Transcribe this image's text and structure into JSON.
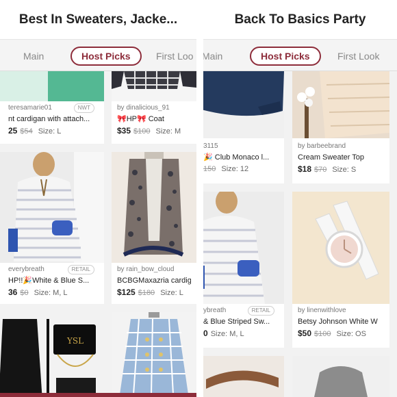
{
  "left": {
    "title": "Best In Sweaters, Jacke...",
    "tabs": [
      "Main",
      "Host Picks",
      "First Loo"
    ],
    "cards": [
      {
        "seller": "teresamarie01",
        "badge": "NWT",
        "title": "nt cardigan with attach...",
        "price": "25",
        "orig": "$54",
        "size": "Size: L"
      },
      {
        "seller": "by dinalicious_91",
        "title": "🎀HP🎀 Coat",
        "price": "$35",
        "orig": "$100",
        "size": "Size: M"
      },
      {
        "seller": "everybreath",
        "badge": "RETAIL",
        "title": "HP!!🎉White & Blue S...",
        "price": "36",
        "orig": "$0",
        "size": "Size: M, L"
      },
      {
        "seller": "by rain_bow_cloud",
        "title": "BCBGMaxazria cardig",
        "price": "$125",
        "orig": "$180",
        "size": "Size: L"
      }
    ]
  },
  "right": {
    "title": "Back To Basics Party",
    "tabs": [
      "Main",
      "Host Picks",
      "First Look"
    ],
    "cards": [
      {
        "seller": "3115",
        "title": "🎉 Club Monaco l...",
        "price": "",
        "orig": "150",
        "size": "Size: 12"
      },
      {
        "seller": "by barbeebrand",
        "title": "Cream Sweater Top",
        "price": "$18",
        "orig": "$70",
        "size": "Size: S"
      },
      {
        "seller": "ybreath",
        "badge": "RETAIL",
        "title": "& Blue Striped Sw...",
        "price": "0",
        "orig": "",
        "size": "Size: M, L"
      },
      {
        "seller": "by linenwithlove",
        "title": "Betsy Johnson White W",
        "price": "$50",
        "orig": "$100",
        "size": "Size: OS"
      }
    ]
  },
  "colors": {
    "accent": "#8d2c3a",
    "background": "#f2f2f2"
  }
}
